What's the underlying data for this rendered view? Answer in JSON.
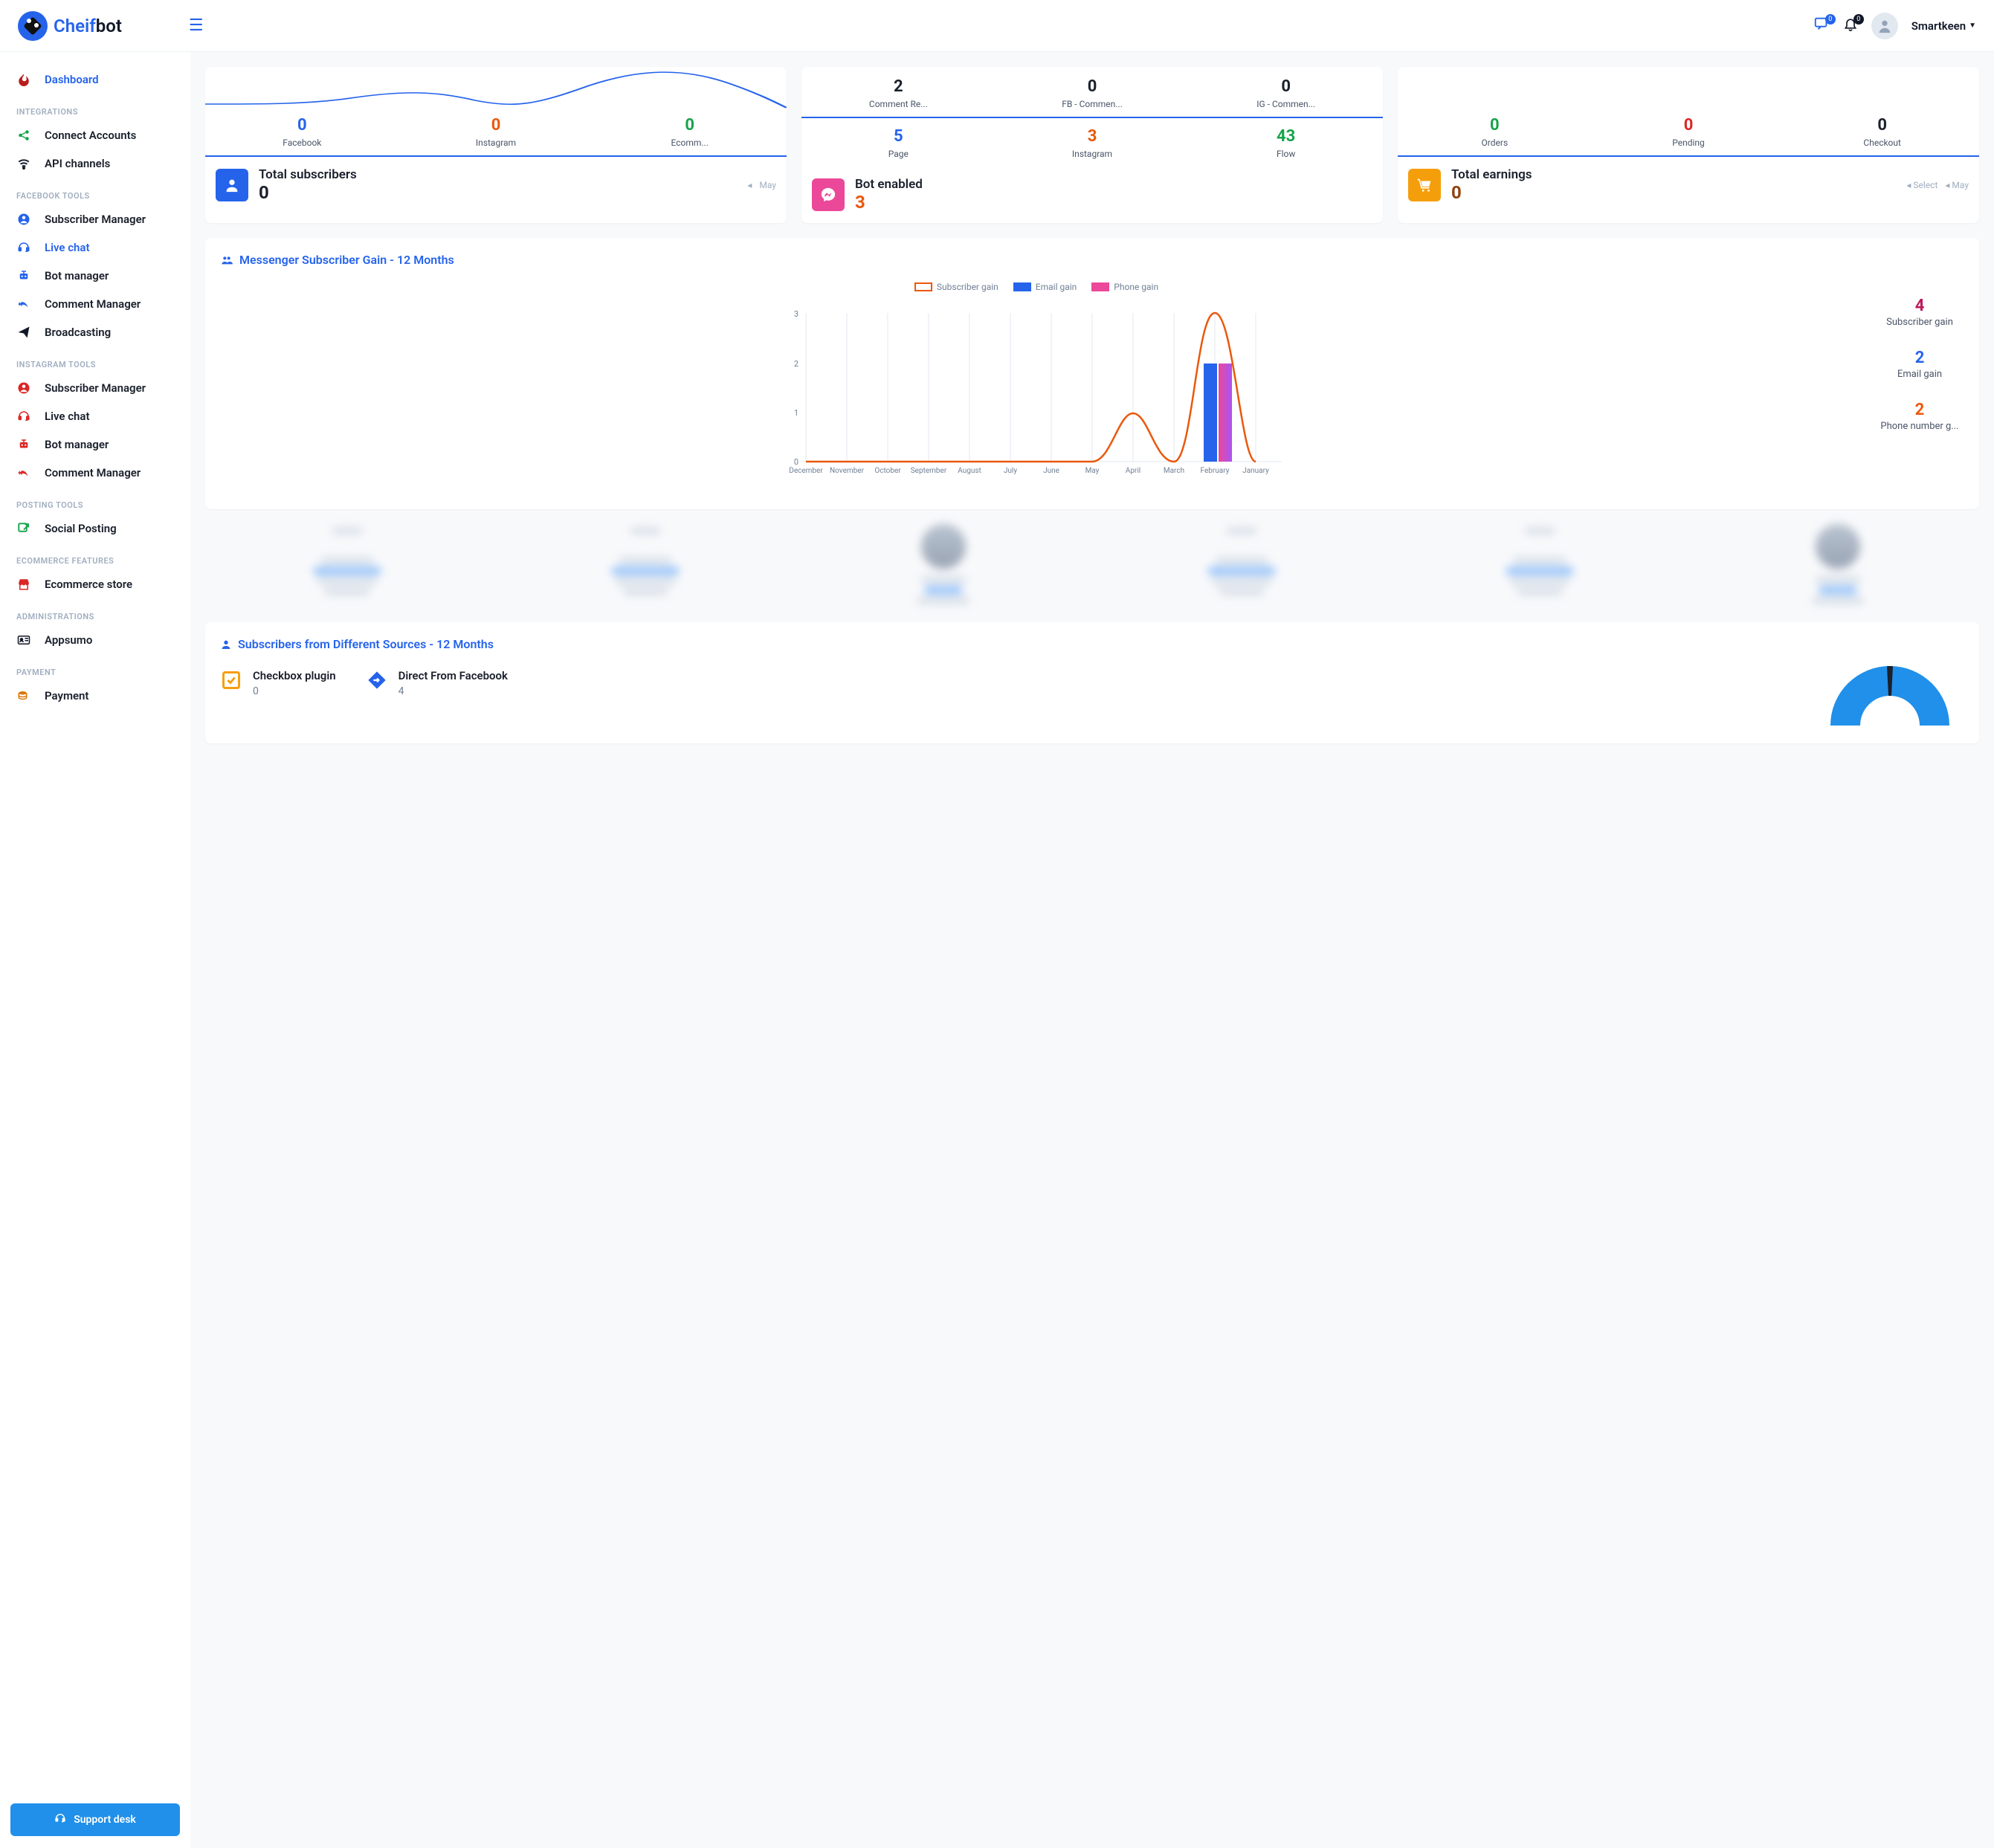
{
  "header": {
    "logo_c": "Cheif",
    "logo_b": "bot",
    "msg_badge": "0",
    "bell_badge": "0",
    "username": "Smartkeen"
  },
  "sidebar": {
    "items": [
      {
        "label": "Dashboard",
        "active": true,
        "color": "#2563eb",
        "icon": "flame",
        "ic_color": "#b91c1c"
      },
      {
        "group": "INTEGRATIONS"
      },
      {
        "label": "Connect Accounts",
        "icon": "share",
        "ic_color": "#16a34a"
      },
      {
        "label": "API channels",
        "icon": "wifi",
        "ic_color": "#111827"
      },
      {
        "group": "FACEBOOK TOOLS"
      },
      {
        "label": "Subscriber Manager",
        "icon": "user-circle",
        "ic_color": "#2563eb"
      },
      {
        "label": "Live chat",
        "active_link": true,
        "icon": "headset",
        "ic_color": "#2563eb"
      },
      {
        "label": "Bot manager",
        "icon": "robot",
        "ic_color": "#2563eb"
      },
      {
        "label": "Comment Manager",
        "icon": "reply-all",
        "ic_color": "#2563eb"
      },
      {
        "label": "Broadcasting",
        "icon": "paper-plane",
        "ic_color": "#111827"
      },
      {
        "group": "INSTAGRAM TOOLS"
      },
      {
        "label": "Subscriber Manager",
        "icon": "user-circle",
        "ic_color": "#dc2626"
      },
      {
        "label": "Live chat",
        "icon": "headset",
        "ic_color": "#dc2626"
      },
      {
        "label": "Bot manager",
        "icon": "robot",
        "ic_color": "#dc2626"
      },
      {
        "label": "Comment Manager",
        "icon": "reply-all",
        "ic_color": "#dc2626"
      },
      {
        "group": "POSTING TOOLS"
      },
      {
        "label": "Social Posting",
        "icon": "share-out",
        "ic_color": "#16a34a"
      },
      {
        "group": "ECOMMERCE FEATURES"
      },
      {
        "label": "Ecommerce store",
        "icon": "store",
        "ic_color": "#dc2626"
      },
      {
        "group": "ADMINISTRATIONS"
      },
      {
        "label": "Appsumo",
        "icon": "id-card",
        "ic_color": "#111827"
      },
      {
        "group": "PAYMENT"
      },
      {
        "label": "Payment",
        "icon": "coins",
        "ic_color": "#d97706"
      }
    ],
    "support": "Support desk"
  },
  "card1": {
    "m": [
      {
        "value": "0",
        "label": "Facebook",
        "color": "#2563eb"
      },
      {
        "value": "0",
        "label": "Instagram",
        "color": "#ea580c"
      },
      {
        "value": "0",
        "label": "Ecomm...",
        "color": "#16a34a"
      }
    ],
    "foot_label": "Total subscribers",
    "foot_val": "0",
    "foot_meta": "May",
    "icon_bg": "#2563eb"
  },
  "card2": {
    "r1": [
      {
        "value": "2",
        "label": "Comment Re...",
        "color": "#1a202c"
      },
      {
        "value": "0",
        "label": "FB - Commen...",
        "color": "#1a202c"
      },
      {
        "value": "0",
        "label": "IG - Commen...",
        "color": "#1a202c"
      }
    ],
    "r2": [
      {
        "value": "5",
        "label": "Page",
        "color": "#2563eb"
      },
      {
        "value": "3",
        "label": "Instagram",
        "color": "#ea580c"
      },
      {
        "value": "43",
        "label": "Flow",
        "color": "#16a34a"
      }
    ],
    "foot_label": "Bot enabled",
    "foot_val": "3",
    "icon_bg": "#ec4899",
    "foot_val_color": "#ea580c"
  },
  "card3": {
    "m": [
      {
        "value": "0",
        "label": "Orders",
        "color": "#16a34a"
      },
      {
        "value": "0",
        "label": "Pending",
        "color": "#dc2626"
      },
      {
        "value": "0",
        "label": "Checkout",
        "color": "#1a202c"
      }
    ],
    "foot_label": "Total earnings",
    "foot_val": "0",
    "foot_meta_select": "Select",
    "foot_meta_month": "May",
    "icon_bg": "#f59e0b",
    "foot_val_color": "#92400e"
  },
  "subscriber_chart": {
    "title": "Messenger Subscriber Gain - 12 Months",
    "legend": [
      {
        "name": "Subscriber gain",
        "color": "#ea580c",
        "outline": true
      },
      {
        "name": "Email gain",
        "color": "#2563eb"
      },
      {
        "name": "Phone gain",
        "color": "#ec4899"
      }
    ],
    "side": [
      {
        "v": "4",
        "l": "Subscriber gain",
        "color": "#be185d"
      },
      {
        "v": "2",
        "l": "Email gain",
        "color": "#2563eb"
      },
      {
        "v": "2",
        "l": "Phone number g...",
        "color": "#ea580c"
      }
    ]
  },
  "chart_data": {
    "type": "line+bar",
    "title": "Messenger Subscriber Gain - 12 Months",
    "categories": [
      "December",
      "November",
      "October",
      "September",
      "August",
      "July",
      "June",
      "May",
      "April",
      "March",
      "February",
      "January"
    ],
    "ylim": [
      0,
      3
    ],
    "series": [
      {
        "name": "Subscriber gain",
        "type": "line",
        "color": "#ea580c",
        "values": [
          0,
          0,
          0,
          0,
          0,
          0,
          0,
          0,
          1,
          0,
          3,
          0
        ]
      },
      {
        "name": "Email gain",
        "type": "bar",
        "color": "#2563eb",
        "values": [
          0,
          0,
          0,
          0,
          0,
          0,
          0,
          0,
          0,
          0,
          2,
          0
        ]
      },
      {
        "name": "Phone gain",
        "type": "bar",
        "color": "#ec4899",
        "values": [
          0,
          0,
          0,
          0,
          0,
          0,
          0,
          0,
          0,
          0,
          2,
          0
        ]
      }
    ]
  },
  "sources_panel": {
    "title": "Subscribers from Different Sources - 12 Months",
    "items": [
      {
        "label": "Checkbox plugin",
        "val": "0",
        "icon": "checkbox",
        "color": "#f59e0b"
      },
      {
        "label": "Direct From Facebook",
        "val": "4",
        "icon": "direction",
        "color": "#2563eb"
      }
    ]
  }
}
